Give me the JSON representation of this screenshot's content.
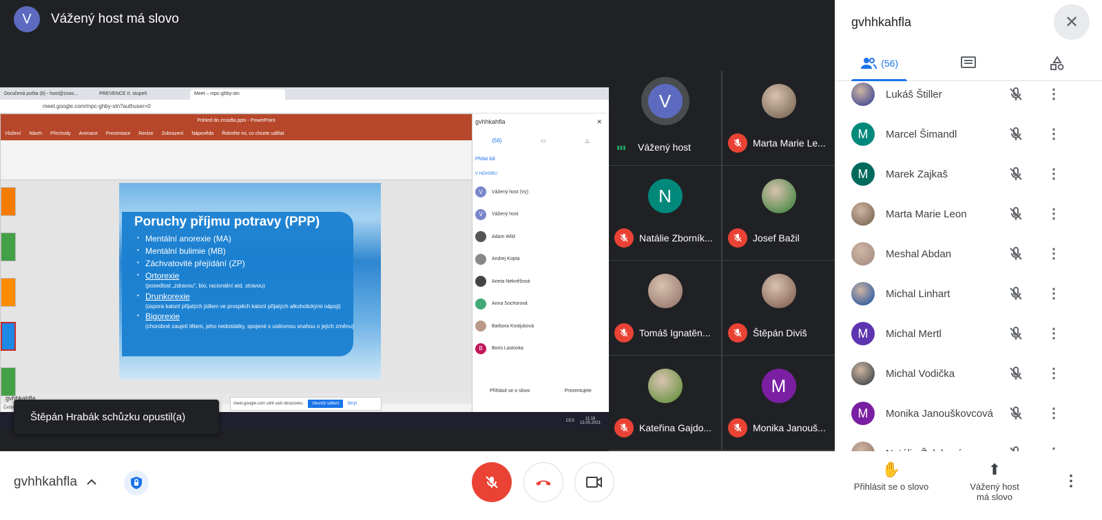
{
  "topbar": {
    "avatar_letter": "V",
    "title": "Vážený host má slovo"
  },
  "screen": {
    "tabs": [
      "Doručená pošta (8) - host@zsoo...",
      "PREVENCE II. stupeň",
      "Meet – mpc-ghby-stn"
    ],
    "url": "meet.google.com/mpc-ghby-stn?authuser=0",
    "ppt_title": "Pohled do zrcadla.pptx - PowerPoint",
    "ppt_menu": [
      "Vložení",
      "Návrh",
      "Přechody",
      "Animace",
      "Prezentace",
      "Revize",
      "Zobrazení",
      "Nápověda",
      "Řekněte mi, co chcete udělat"
    ],
    "slide": {
      "heading": "Poruchy příjmu potravy (PPP)",
      "items": [
        {
          "text": "Mentální anorexie (MA)",
          "sub": ""
        },
        {
          "text": "Mentální bulimie (MB)",
          "sub": ""
        },
        {
          "text": "Záchvatovité přejídání (ZP)",
          "sub": ""
        },
        {
          "text": "Ortorexie",
          "sub": "(posedlost „zdravou“, bio, racionální atd. stravou)"
        },
        {
          "text": "Drunkorexie",
          "sub": "(úspora kalorií přijatých jídlem ve prospěch kalorií přijatých alkoholickými nápoji)"
        },
        {
          "text": "Bigorexie",
          "sub": "(chorobné zaujetí tělem, jeho nedostatky, spojené s usilovnou snahou o jejich změnu)"
        }
      ]
    },
    "ppt_status": "Čeština",
    "inner_panel": {
      "title": "gvhhkahfla",
      "count": "(56)",
      "add": "Přidat lidi",
      "section": "V HOVORU",
      "people": [
        "Vážený host (Vy)",
        "Vážený host",
        "Adam Wild",
        "Andrej Kopta",
        "Aneta Nekněžová",
        "Anna Sochorová",
        "Barbora Kostjuková",
        "Boris Lastovka"
      ],
      "raise": "Přihlásit se o slovo",
      "present": "Prezentujete"
    },
    "sharebar": {
      "text": "meet.google.com sdílí vaši obrazovku.",
      "stop": "Ukončit sdílení",
      "hide": "Skrýt"
    },
    "inner_code": "gvhhkahfla",
    "clock": "11:18",
    "date": "13.05.2021",
    "lang": "CES"
  },
  "toast": "Štěpán Hrabák schůzku opustil(a)",
  "tiles": [
    {
      "name": "Vážený host",
      "type": "ring",
      "letter": "V",
      "color": "#5c6bc0",
      "speaking": true
    },
    {
      "name": "Marta Marie Le...",
      "type": "photo",
      "letter": "",
      "color": "#6d5a48",
      "speaking": false
    },
    {
      "name": "Natálie Zborník...",
      "type": "letter",
      "letter": "N",
      "color": "#00897b",
      "speaking": false
    },
    {
      "name": "Josef Bažil",
      "type": "photo",
      "letter": "",
      "color": "#2e7d32",
      "speaking": false
    },
    {
      "name": "Tomáš Ignatěn...",
      "type": "photo",
      "letter": "",
      "color": "#8d6e63",
      "speaking": false
    },
    {
      "name": "Štěpán Diviš",
      "type": "photo",
      "letter": "",
      "color": "#795548",
      "speaking": false
    },
    {
      "name": "Kateřina Gajdo...",
      "type": "photo",
      "letter": "",
      "color": "#558b2f",
      "speaking": false
    },
    {
      "name": "Monika Janouš...",
      "type": "letter",
      "letter": "M",
      "color": "#7b1fa2",
      "speaking": false
    }
  ],
  "panel": {
    "title": "gvhhkahfla",
    "people_count": "(56)",
    "people": [
      {
        "name": "Lukáš Štiller",
        "letter": "",
        "color": "#283593"
      },
      {
        "name": "Marcel Šimandl",
        "letter": "M",
        "color": "#00897b"
      },
      {
        "name": "Marek Zajkaš",
        "letter": "M",
        "color": "#00695c"
      },
      {
        "name": "Marta Marie Leon",
        "letter": "",
        "color": "#6d5a48"
      },
      {
        "name": "Meshal Abdan",
        "letter": "",
        "color": "#a1887f"
      },
      {
        "name": "Michal Linhart",
        "letter": "",
        "color": "#0d47a1"
      },
      {
        "name": "Michal Mertl",
        "letter": "M",
        "color": "#5e35b1"
      },
      {
        "name": "Michal Vodička",
        "letter": "",
        "color": "#263238"
      },
      {
        "name": "Monika Janouškovcová",
        "letter": "M",
        "color": "#7b1fa2"
      },
      {
        "name": "Natálie Žaloková",
        "letter": "",
        "color": "#8d6e63"
      }
    ]
  },
  "bottombar": {
    "meeting_code": "gvhhkahfla",
    "raise_hand": "Přihlásit se o slovo",
    "present_line1": "Vážený host",
    "present_line2": "má slovo"
  },
  "colors": {
    "accent": "#1a73e8",
    "danger": "#ea4335",
    "dark": "#202124"
  }
}
